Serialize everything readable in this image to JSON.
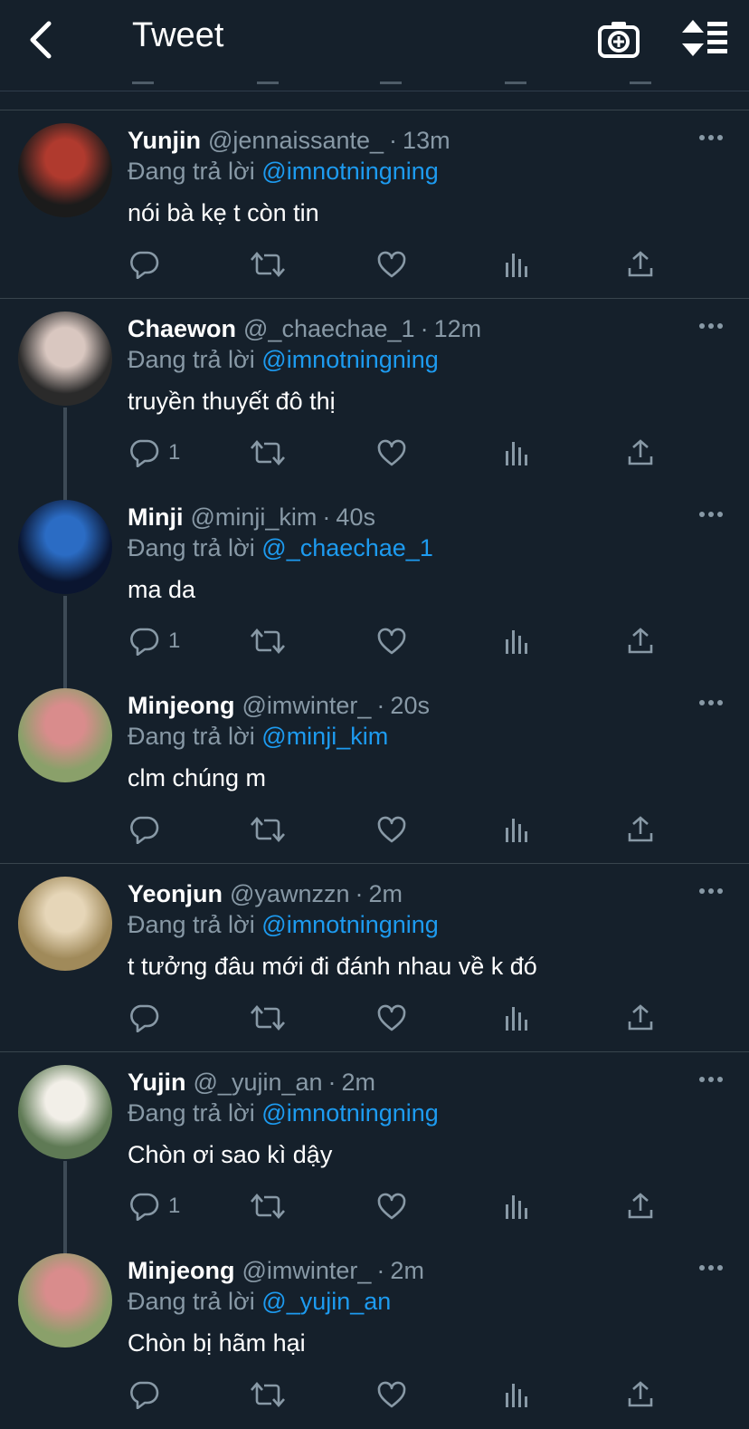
{
  "header": {
    "title": "Tweet"
  },
  "tweets": [
    {
      "name": "Yunjin",
      "handle": "@jennaissante_",
      "time": "13m",
      "replying_label": "Đang trả lời",
      "mention": "@imnotningning",
      "text": "nói bà kẹ t còn tin",
      "reply_count": "",
      "avatar_colors": [
        "#1b1b1b",
        "#b03a2e"
      ]
    },
    {
      "name": "Chaewon",
      "handle": "@_chaechae_1",
      "time": "12m",
      "replying_label": "Đang trả lời",
      "mention": "@imnotningning",
      "text": "truyền thuyết đô thị",
      "reply_count": "1",
      "avatar_colors": [
        "#2a2a2a",
        "#d9c7c0"
      ]
    },
    {
      "name": "Minji",
      "handle": "@minji_kim",
      "time": "40s",
      "replying_label": "Đang trả lời",
      "mention": "@_chaechae_1",
      "text": "ma da",
      "reply_count": "1",
      "avatar_colors": [
        "#0a1530",
        "#2b6cc4"
      ]
    },
    {
      "name": "Minjeong",
      "handle": "@imwinter_",
      "time": "20s",
      "replying_label": "Đang trả lời",
      "mention": "@minji_kim",
      "text": "clm chúng m",
      "reply_count": "",
      "avatar_colors": [
        "#8aa06a",
        "#d98c8c"
      ]
    },
    {
      "name": "Yeonjun",
      "handle": "@yawnzzn",
      "time": "2m",
      "replying_label": "Đang trả lời",
      "mention": "@imnotningning",
      "text": "t tưởng đâu mới đi đánh nhau về k đó",
      "reply_count": "",
      "avatar_colors": [
        "#a08a5a",
        "#e6d6b8"
      ]
    },
    {
      "name": "Yujin",
      "handle": "@_yujin_an",
      "time": "2m",
      "replying_label": "Đang trả lời",
      "mention": "@imnotningning",
      "text": "Chòn ơi sao kì dậy",
      "reply_count": "1",
      "avatar_colors": [
        "#5f7a55",
        "#f2efe8"
      ]
    },
    {
      "name": "Minjeong",
      "handle": "@imwinter_",
      "time": "2m",
      "replying_label": "Đang trả lời",
      "mention": "@_yujin_an",
      "text": "Chòn bị hãm hại",
      "reply_count": "",
      "avatar_colors": [
        "#8aa06a",
        "#d98c8c"
      ]
    }
  ],
  "icons": {
    "back": "chevron-left-icon",
    "camera": "camera-icon",
    "sort": "sort-icon",
    "reply": "reply-icon",
    "retweet": "retweet-icon",
    "like": "heart-icon",
    "analytics": "analytics-icon",
    "share": "share-icon",
    "more": "more-icon"
  },
  "colors": {
    "background": "#15202b",
    "accent": "#1d9bf0",
    "muted": "#8899a6"
  }
}
